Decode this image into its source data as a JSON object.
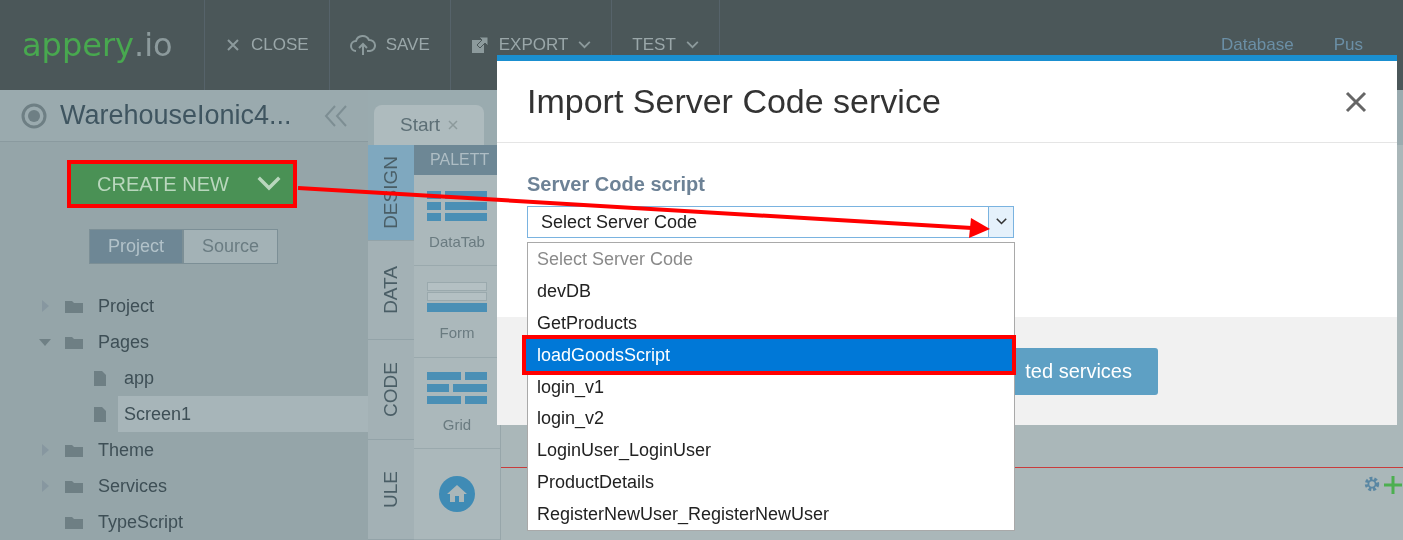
{
  "app_bar": {
    "logo": {
      "brand": "appery",
      "suffix": ".io"
    },
    "actions": [
      {
        "label": "CLOSE",
        "kind": "close",
        "dropdown": false
      },
      {
        "label": "SAVE",
        "kind": "save",
        "dropdown": false
      },
      {
        "label": "EXPORT",
        "kind": "export",
        "dropdown": true
      },
      {
        "label": "TEST",
        "kind": "test",
        "dropdown": true
      }
    ],
    "links": [
      "Database",
      "Pus"
    ]
  },
  "project": {
    "title": "WarehouseIonic4...",
    "create_button": "CREATE NEW",
    "view_toggle": [
      {
        "label": "Project",
        "selected": true
      },
      {
        "label": "Source",
        "selected": false
      }
    ],
    "tree": [
      {
        "label": "Project",
        "kind": "folder",
        "expanded": false,
        "selected": false
      },
      {
        "label": "Pages",
        "kind": "folder",
        "expanded": true,
        "selected": false,
        "children": [
          {
            "label": "app",
            "kind": "page",
            "selected": false
          },
          {
            "label": "Screen1",
            "kind": "page",
            "selected": true
          }
        ]
      },
      {
        "label": "Theme",
        "kind": "folder",
        "expanded": false,
        "selected": false
      },
      {
        "label": "Services",
        "kind": "folder",
        "expanded": false,
        "selected": false
      },
      {
        "label": "TypeScript",
        "kind": "plain-folder",
        "selected": false
      }
    ]
  },
  "editor_tabs": [
    {
      "label": "Start",
      "selected": true
    }
  ],
  "side_tabs": [
    {
      "label": "DESIGN",
      "selected": true
    },
    {
      "label": "DATA",
      "selected": false
    },
    {
      "label": "CODE",
      "selected": false
    },
    {
      "label": "ULE",
      "selected": false
    }
  ],
  "palette": {
    "title": "PALETT",
    "items": [
      {
        "label": "DataTab",
        "kind": "datatable"
      },
      {
        "label": "Form",
        "kind": "form"
      },
      {
        "label": "Grid",
        "kind": "grid"
      },
      {
        "kind": "home"
      }
    ]
  },
  "dialog": {
    "title": "Import Server Code service",
    "field_label": "Server Code script",
    "select": {
      "value": "Select Server Code",
      "expanded": true
    },
    "options": [
      {
        "label": "Select Server Code",
        "kind": "placeholder",
        "selected": false
      },
      {
        "label": "devDB",
        "kind": "option",
        "selected": false
      },
      {
        "label": "GetProducts",
        "kind": "option",
        "selected": false
      },
      {
        "label": "loadGoodsScript",
        "kind": "option",
        "selected": true
      },
      {
        "label": "login_v1",
        "kind": "option",
        "selected": false
      },
      {
        "label": "login_v2",
        "kind": "option",
        "selected": false
      },
      {
        "label": "LoginUser_LoginUser",
        "kind": "option",
        "selected": false
      },
      {
        "label": "ProductDetails",
        "kind": "option",
        "selected": false
      },
      {
        "label": "RegisterNewUser_RegisterNewUser",
        "kind": "option",
        "selected": false
      }
    ],
    "footer_button": "ted services"
  }
}
